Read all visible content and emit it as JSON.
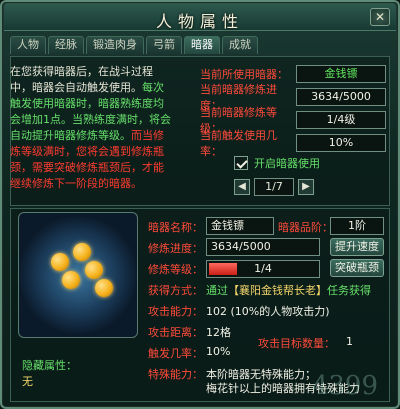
{
  "window": {
    "title": "人物属性",
    "close_glyph": "✕"
  },
  "tabs": [
    {
      "label": "人物"
    },
    {
      "label": "经脉"
    },
    {
      "label": "锻造肉身"
    },
    {
      "label": "弓箭"
    },
    {
      "label": "暗器"
    },
    {
      "label": "成就"
    }
  ],
  "intro": {
    "line1": "在您获得暗器后，在战斗过程",
    "line2": "中，暗器会自动触发使用。",
    "line2_green": "每次",
    "line3_green": "触发使用暗器时，暗器熟练度均",
    "line4_green": "会增加1点。当熟练度满时，将会",
    "line5_green": "自动提升暗器修炼等级。",
    "line5_red": "而当修",
    "line6_red": "炼等级满时，您将会遇到修炼瓶",
    "line7_red": "颈，需要突破修炼瓶颈后，才能",
    "line8_red": "继续修炼下一阶段的暗器。"
  },
  "stats": [
    {
      "label": "当前所使用暗器：",
      "value": "金钱镖"
    },
    {
      "label": "当前暗器修炼进度：",
      "value": "3634/5000"
    },
    {
      "label": "当前暗器修炼等级：",
      "value": "1/4级"
    },
    {
      "label": "当前触发使用几率：",
      "value": "10%"
    }
  ],
  "enable_weapon": {
    "label": "开启暗器使用",
    "checked": true
  },
  "pager": {
    "value": "1/7",
    "prev_glyph": "◀",
    "next_glyph": "▶"
  },
  "detail": {
    "name_label": "暗器名称：",
    "name_value": "金钱镖",
    "grade_label": "暗器品阶：",
    "grade_value": "1阶",
    "progress_label": "修炼进度：",
    "progress_value": "3634/5000",
    "speed_button": "提升速度",
    "level_label": "修炼等级：",
    "level_value": "1/4",
    "level_fraction": 0.25,
    "breakthrough_button": "突破瓶颈",
    "obtain_label": "获得方式：",
    "obtain_value_prefix": "通过",
    "obtain_value_task": "【襄阳金钱帮长老】",
    "obtain_value_suffix": "任务获得",
    "attack_label": "攻击能力：",
    "attack_value": "102 (10%的人物攻击力)",
    "distance_label": "攻击距离：",
    "distance_value": "12格",
    "targets_label": "攻击目标数量：",
    "targets_value": "1",
    "trigger_label": "触发几率：",
    "trigger_value": "10%",
    "special_label": "特殊能力：",
    "special_line1": "本阶暗器无特殊能力；",
    "special_line2": "梅花针以上的暗器拥有特殊能力"
  },
  "hidden_attr": {
    "label": "隐藏属性：",
    "value": "无"
  },
  "watermark": "4399"
}
